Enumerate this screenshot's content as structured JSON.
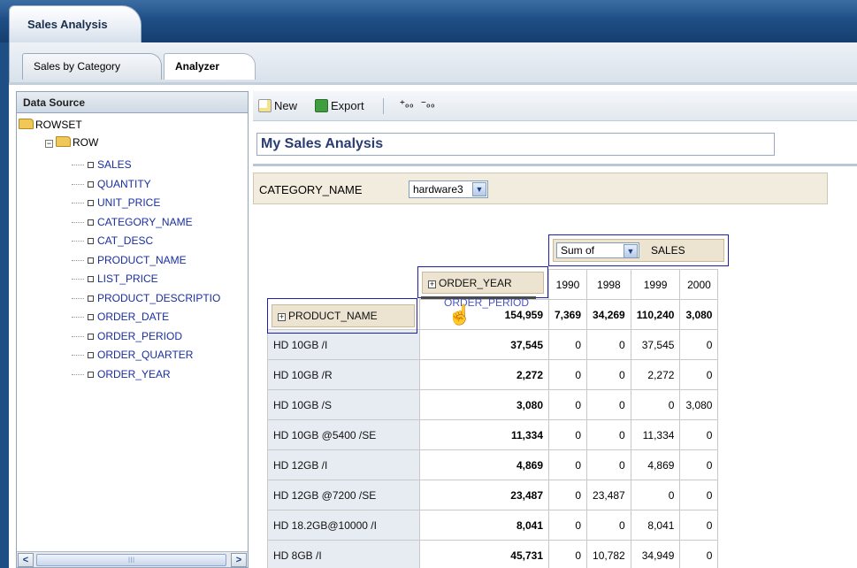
{
  "app": {
    "tab_title": "Sales Analysis"
  },
  "subtabs": [
    {
      "label": "Sales by Category"
    },
    {
      "label": "Analyzer"
    }
  ],
  "data_source": {
    "header": "Data Source",
    "root": "ROWSET",
    "child": "ROW",
    "fields": [
      "SALES",
      "QUANTITY",
      "UNIT_PRICE",
      "CATEGORY_NAME",
      "CAT_DESC",
      "PRODUCT_NAME",
      "LIST_PRICE",
      "PRODUCT_DESCRIPTIO",
      "ORDER_DATE",
      "ORDER_PERIOD",
      "ORDER_QUARTER",
      "ORDER_YEAR"
    ]
  },
  "toolbar": {
    "new_label": "New",
    "export_label": "Export"
  },
  "analysis": {
    "title": "My Sales Analysis",
    "filter": {
      "label": "CATEGORY_NAME",
      "value": "hardware3"
    },
    "measure": {
      "aggregate": "Sum of",
      "field": "SALES"
    },
    "column_field": "ORDER_YEAR",
    "row_field": "PRODUCT_NAME",
    "drag_ghost": "ORDER_PERIOD",
    "years": [
      "1990",
      "1998",
      "1999",
      "2000"
    ],
    "grand_total": {
      "total": "154,959",
      "values": [
        "7,369",
        "34,269",
        "110,240",
        "3,080"
      ]
    },
    "rows": [
      {
        "name": "HD 10GB /I",
        "total": "37,545",
        "values": [
          "0",
          "0",
          "37,545",
          "0"
        ]
      },
      {
        "name": "HD 10GB /R",
        "total": "2,272",
        "values": [
          "0",
          "0",
          "2,272",
          "0"
        ]
      },
      {
        "name": "HD 10GB /S",
        "total": "3,080",
        "values": [
          "0",
          "0",
          "0",
          "3,080"
        ]
      },
      {
        "name": "HD 10GB @5400 /SE",
        "total": "11,334",
        "values": [
          "0",
          "0",
          "11,334",
          "0"
        ]
      },
      {
        "name": "HD 12GB /I",
        "total": "4,869",
        "values": [
          "0",
          "0",
          "4,869",
          "0"
        ]
      },
      {
        "name": "HD 12GB @7200 /SE",
        "total": "23,487",
        "values": [
          "0",
          "23,487",
          "0",
          "0"
        ]
      },
      {
        "name": "HD 18.2GB@10000 /I",
        "total": "8,041",
        "values": [
          "0",
          "0",
          "8,041",
          "0"
        ]
      },
      {
        "name": "HD 8GB /I",
        "total": "45,731",
        "values": [
          "0",
          "10,782",
          "34,949",
          "0"
        ]
      }
    ]
  }
}
